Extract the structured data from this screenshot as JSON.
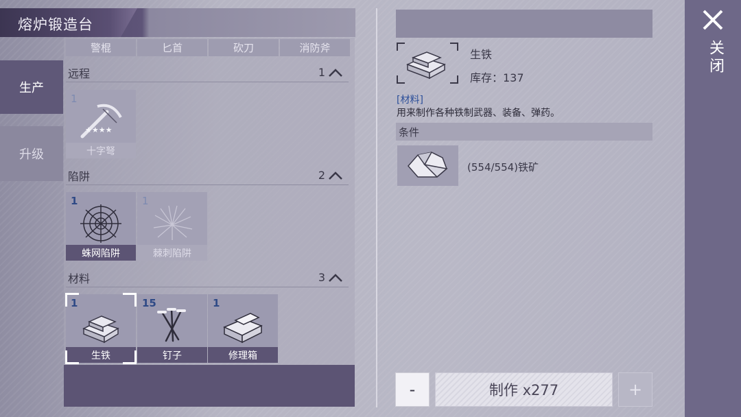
{
  "title": "熔炉锻造台",
  "side_tabs": [
    {
      "label": "生产",
      "active": true
    },
    {
      "label": "升级",
      "active": false
    }
  ],
  "category_tabs": [
    "警棍",
    "匕首",
    "砍刀",
    "消防斧"
  ],
  "sections": [
    {
      "name": "远程",
      "count": "1",
      "items": [
        {
          "qty": "1",
          "label": "十字弩",
          "icon": "crossbow-icon"
        }
      ]
    },
    {
      "name": "陷阱",
      "count": "2",
      "items": [
        {
          "qty": "1",
          "label": "蛛网陷阱",
          "icon": "spiderweb-trap-icon"
        },
        {
          "qty": "1",
          "label": "棘刺陷阱",
          "icon": "spike-trap-icon"
        }
      ]
    },
    {
      "name": "材料",
      "count": "3",
      "items": [
        {
          "qty": "1",
          "label": "生铁",
          "icon": "pig-iron-icon"
        },
        {
          "qty": "15",
          "label": "钉子",
          "icon": "nails-icon"
        },
        {
          "qty": "1",
          "label": "修理箱",
          "icon": "repair-kit-icon"
        }
      ]
    }
  ],
  "detail": {
    "name": "生铁",
    "stock": "库存：137",
    "tag": "[材料]",
    "description": "用来制作各种铁制武器、装备、弹药。",
    "conditions_label": "条件",
    "condition_text": "(554/554)铁矿"
  },
  "buttons": {
    "minus": "-",
    "make": "制作 x277",
    "plus": "+"
  },
  "close_label": "关闭",
  "colors": {
    "accent_dark": "#5c5474",
    "qty_blue": "#2f4a86"
  }
}
